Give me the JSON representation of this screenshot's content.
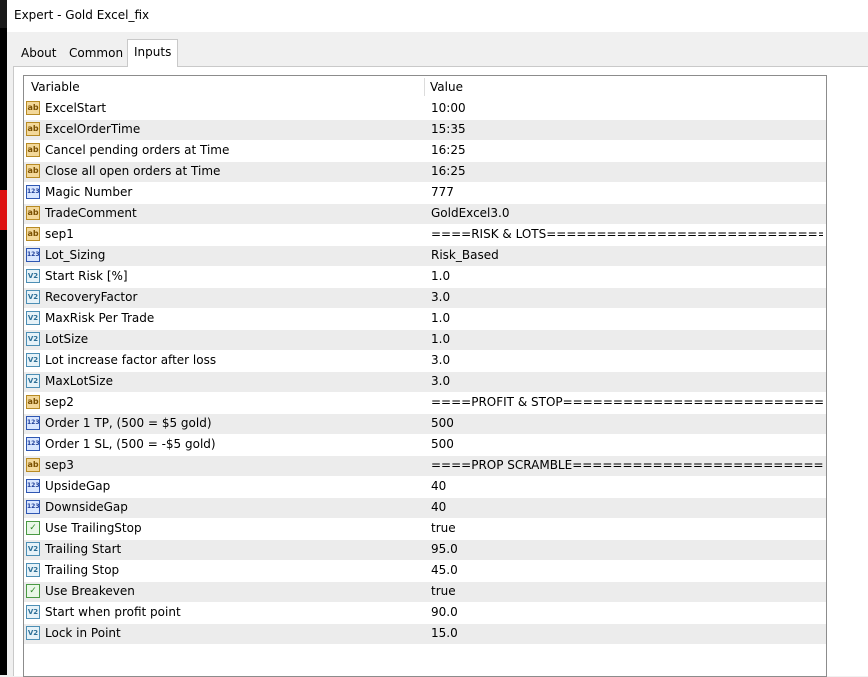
{
  "window": {
    "title": "Expert - Gold Excel_fix"
  },
  "tabs": [
    {
      "label": "About"
    },
    {
      "label": "Common"
    },
    {
      "label": "Inputs"
    }
  ],
  "grid": {
    "columns": {
      "variable": "Variable",
      "value": "Value"
    },
    "rows": [
      {
        "type": "ab",
        "icon_text": "ab",
        "name": "ExcelStart",
        "value": "10:00"
      },
      {
        "type": "ab",
        "icon_text": "ab",
        "name": "ExcelOrderTime",
        "value": "15:35"
      },
      {
        "type": "ab",
        "icon_text": "ab",
        "name": "Cancel pending orders at Time",
        "value": "16:25"
      },
      {
        "type": "ab",
        "icon_text": "ab",
        "name": "Close all open orders at Time",
        "value": "16:25"
      },
      {
        "type": "int",
        "icon_text": "123",
        "name": "Magic Number",
        "value": "777"
      },
      {
        "type": "ab",
        "icon_text": "ab",
        "name": "TradeComment",
        "value": "GoldExcel3.0"
      },
      {
        "type": "ab",
        "icon_text": "ab",
        "name": "sep1",
        "value": "====RISK & LOTS=============================..."
      },
      {
        "type": "int",
        "icon_text": "123",
        "name": "Lot_Sizing",
        "value": "Risk_Based"
      },
      {
        "type": "dbl",
        "icon_text": "V2",
        "name": "Start Risk [%]",
        "value": "1.0"
      },
      {
        "type": "dbl",
        "icon_text": "V2",
        "name": "RecoveryFactor",
        "value": "3.0"
      },
      {
        "type": "dbl",
        "icon_text": "V2",
        "name": "MaxRisk Per Trade",
        "value": "1.0"
      },
      {
        "type": "dbl",
        "icon_text": "V2",
        "name": "LotSize",
        "value": "1.0"
      },
      {
        "type": "dbl",
        "icon_text": "V2",
        "name": "Lot increase factor after loss",
        "value": "3.0"
      },
      {
        "type": "dbl",
        "icon_text": "V2",
        "name": "MaxLotSize",
        "value": "3.0"
      },
      {
        "type": "ab",
        "icon_text": "ab",
        "name": "sep2",
        "value": "====PROFIT & STOP============================..."
      },
      {
        "type": "int",
        "icon_text": "123",
        "name": "Order 1 TP, (500 = $5 gold)",
        "value": "500"
      },
      {
        "type": "int",
        "icon_text": "123",
        "name": "Order 1 SL, (500 = -$5 gold)",
        "value": "500"
      },
      {
        "type": "ab",
        "icon_text": "ab",
        "name": "sep3",
        "value": "====PROP SCRAMBLE==========================..."
      },
      {
        "type": "int",
        "icon_text": "123",
        "name": "UpsideGap",
        "value": "40"
      },
      {
        "type": "int",
        "icon_text": "123",
        "name": "DownsideGap",
        "value": "40"
      },
      {
        "type": "bool",
        "icon_text": "✓",
        "name": "Use TrailingStop",
        "value": "true"
      },
      {
        "type": "dbl",
        "icon_text": "V2",
        "name": "Trailing Start",
        "value": "95.0"
      },
      {
        "type": "dbl",
        "icon_text": "V2",
        "name": "Trailing Stop",
        "value": "45.0"
      },
      {
        "type": "bool",
        "icon_text": "✓",
        "name": "Use Breakeven",
        "value": "true"
      },
      {
        "type": "dbl",
        "icon_text": "V2",
        "name": "Start when profit point",
        "value": "90.0"
      },
      {
        "type": "dbl",
        "icon_text": "V2",
        "name": "Lock in Point",
        "value": "15.0"
      }
    ]
  }
}
